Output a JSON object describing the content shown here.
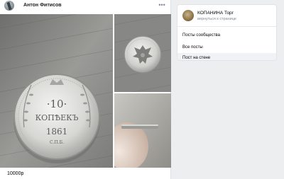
{
  "post": {
    "author_name": "Антон Фитисов",
    "text": "10000р",
    "photos": [
      {
        "subject": "coin-reverse-closeup"
      },
      {
        "subject": "coin-obverse-eagle"
      },
      {
        "subject": "coin-edge-on-finger"
      }
    ]
  },
  "sidebar": {
    "group_name": "КОПАНИНА Торг",
    "back_link": "вернуться к странице",
    "items": [
      {
        "label": "Посты сообщества",
        "active": false
      },
      {
        "label": "Все посты",
        "active": false
      },
      {
        "label": "Пост на стене",
        "active": true
      }
    ]
  },
  "icons": {
    "more": "more-horizontal-icon"
  },
  "colors": {
    "page_background": "#edeef0",
    "card_background": "#ffffff",
    "secondary_text": "#818c99",
    "active_item": "#f0f2f5"
  }
}
